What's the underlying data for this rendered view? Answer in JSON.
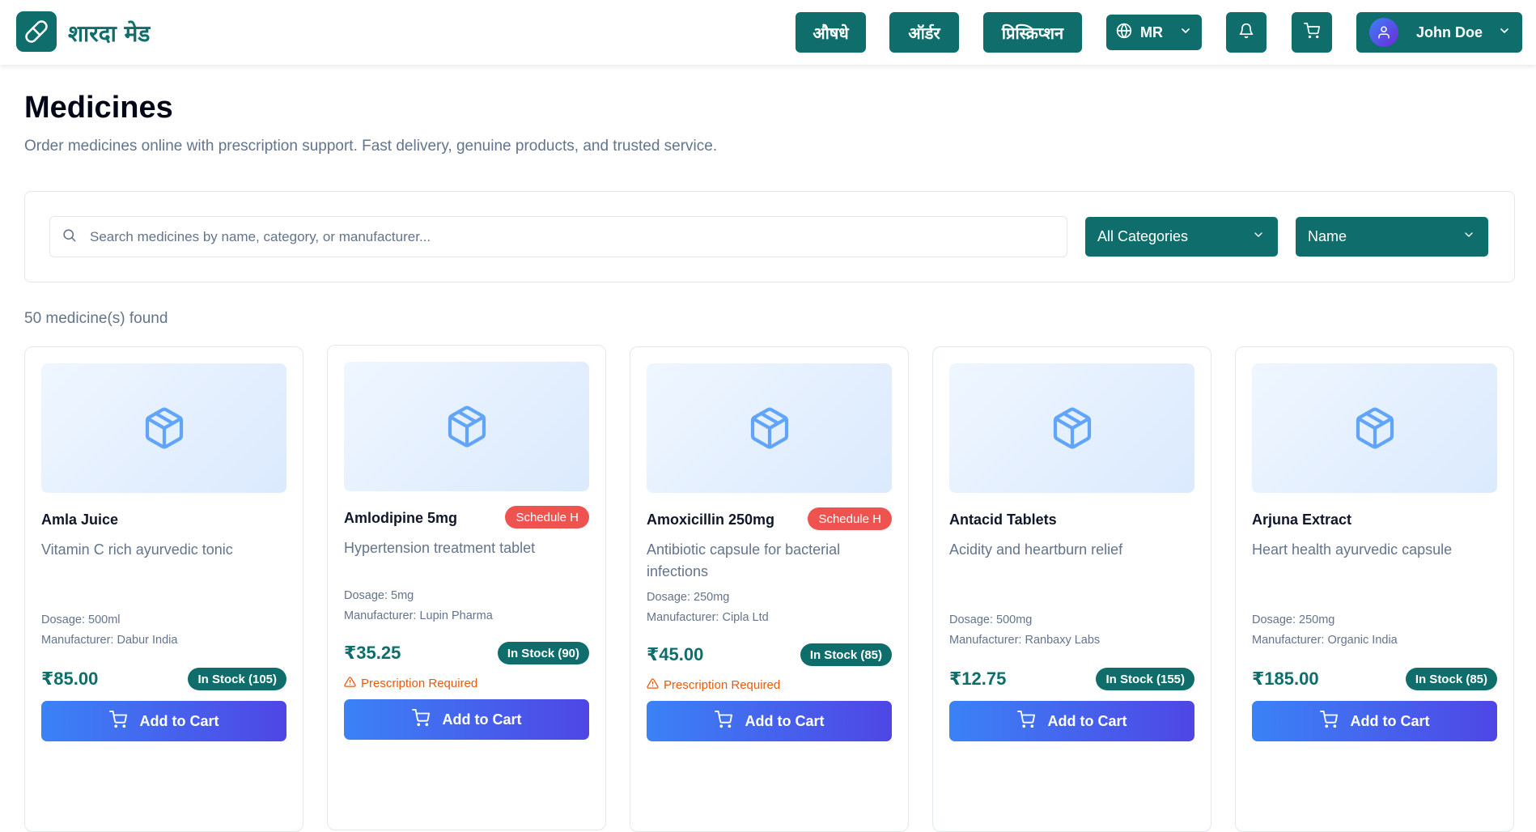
{
  "nav": {
    "brand": "शारदा मेड",
    "links": [
      "औषधे",
      "ऑर्डर",
      "प्रिस्क्रिप्शन"
    ],
    "language": "MR",
    "user_name": "John Doe"
  },
  "header": {
    "title": "Medicines",
    "subtitle": "Order medicines online with prescription support. Fast delivery, genuine products, and trusted service."
  },
  "filters": {
    "search_placeholder": "Search medicines by name, category, or manufacturer...",
    "category": "All Categories",
    "sort": "Name"
  },
  "result_count": "50 medicine(s) found",
  "cards": [
    {
      "name": "Amla Juice",
      "badge": "",
      "description": "Vitamin C rich ayurvedic tonic",
      "dosage": "Dosage: 500ml",
      "manufacturer": "Manufacturer: Dabur India",
      "price": "₹85.00",
      "stock": "In Stock (105)",
      "rx": "",
      "cta": "Add to Cart"
    },
    {
      "name": "Amlodipine 5mg",
      "badge": "Schedule H",
      "description": "Hypertension treatment tablet",
      "dosage": "Dosage: 5mg",
      "manufacturer": "Manufacturer: Lupin Pharma",
      "price": "₹35.25",
      "stock": "In Stock (90)",
      "rx": "Prescription Required",
      "cta": "Add to Cart"
    },
    {
      "name": "Amoxicillin 250mg",
      "badge": "Schedule H",
      "description": "Antibiotic capsule for bacterial infections",
      "dosage": "Dosage: 250mg",
      "manufacturer": "Manufacturer: Cipla Ltd",
      "price": "₹45.00",
      "stock": "In Stock (85)",
      "rx": "Prescription Required",
      "cta": "Add to Cart"
    },
    {
      "name": "Antacid Tablets",
      "badge": "",
      "description": "Acidity and heartburn relief",
      "dosage": "Dosage: 500mg",
      "manufacturer": "Manufacturer: Ranbaxy Labs",
      "price": "₹12.75",
      "stock": "In Stock (155)",
      "rx": "",
      "cta": "Add to Cart"
    },
    {
      "name": "Arjuna Extract",
      "badge": "",
      "description": "Heart health ayurvedic capsule",
      "dosage": "Dosage: 250mg",
      "manufacturer": "Manufacturer: Organic India",
      "price": "₹185.00",
      "stock": "In Stock (85)",
      "rx": "",
      "cta": "Add to Cart"
    }
  ],
  "colors": {
    "primary": "#0f6e6b",
    "badge_red": "#ef5350",
    "rx_orange": "#ea580c",
    "cta_start": "#3b82f6",
    "cta_end": "#4f46e5"
  }
}
